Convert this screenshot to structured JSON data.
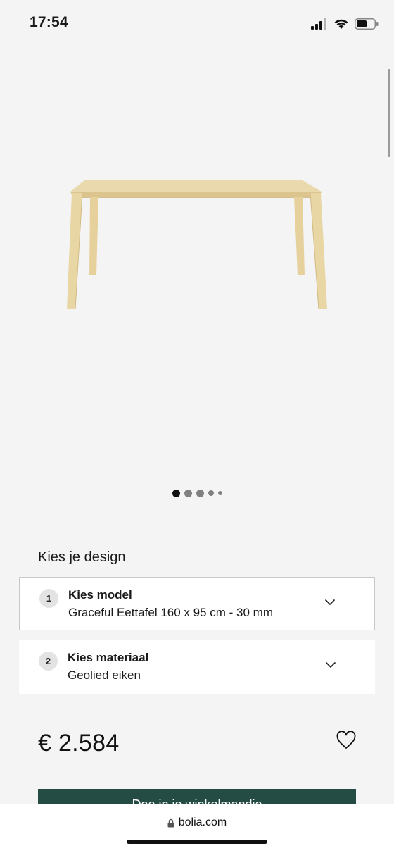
{
  "status_bar": {
    "time": "17:54"
  },
  "carousel": {
    "total_images": 5,
    "active_index": 0
  },
  "design": {
    "heading": "Kies je design",
    "options": [
      {
        "step": "1",
        "title": "Kies model",
        "value": "Graceful Eettafel 160 x 95 cm - 30 mm",
        "selected": true
      },
      {
        "step": "2",
        "title": "Kies materiaal",
        "value": "Geolied eiken",
        "selected": false
      }
    ]
  },
  "price": "€ 2.584",
  "cart_button": {
    "label": "Doe in je winkelmandje"
  },
  "browser": {
    "url": "bolia.com"
  },
  "icons": {
    "signal": "cellular-signal-icon",
    "wifi": "wifi-icon",
    "battery": "battery-icon",
    "chevron": "chevron-down-icon",
    "heart": "heart-icon",
    "lock": "lock-icon"
  },
  "colors": {
    "background": "#f4f4f4",
    "cart_button": "#254b45",
    "wood": "#e3cf9f"
  }
}
